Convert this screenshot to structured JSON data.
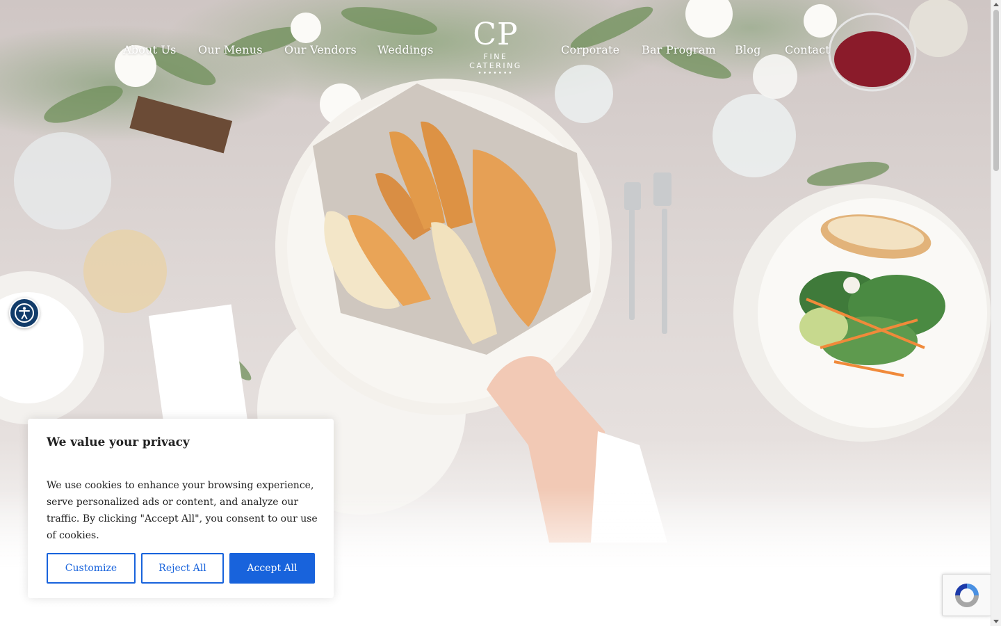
{
  "nav": {
    "left": [
      "About Us",
      "Our Menus",
      "Our Vendors",
      "Weddings"
    ],
    "right": [
      "Corporate",
      "Bar Program",
      "Blog",
      "Contact"
    ]
  },
  "logo": {
    "monogram": "CP",
    "subtitle": "FINE CATERING",
    "dots": "•••••••"
  },
  "cookie_banner": {
    "title": "We value your privacy",
    "body": "We use cookies to enhance your browsing experience, serve personalized ads or content, and analyze our traffic. By clicking \"Accept All\", you consent to our use of cookies.",
    "customize_label": "Customize",
    "reject_label": "Reject All",
    "accept_label": "Accept All"
  },
  "accessibility": {
    "icon": "accessibility-icon"
  },
  "recaptcha": {
    "icon": "recaptcha-icon"
  },
  "colors": {
    "accent": "#1863dc",
    "accessibility_bg": "#123c6a",
    "nav_text": "#ffffff"
  }
}
